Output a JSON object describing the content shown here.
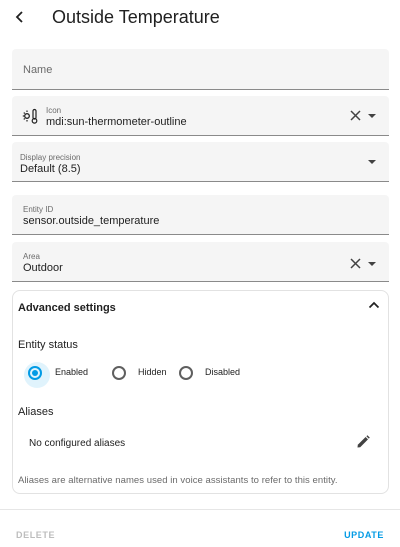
{
  "header": {
    "title": "Outside Temperature"
  },
  "fields": {
    "name": {
      "label": "Name"
    },
    "icon": {
      "label": "Icon",
      "value": "mdi:sun-thermometer-outline"
    },
    "precision": {
      "label": "Display precision",
      "value": "Default (8.5)"
    },
    "entity_id": {
      "label": "Entity ID",
      "value": "sensor.outside_temperature"
    },
    "area": {
      "label": "Area",
      "value": "Outdoor"
    }
  },
  "advanced": {
    "title": "Advanced settings",
    "entity_status": {
      "label": "Entity status",
      "options": [
        "Enabled",
        "Hidden",
        "Disabled"
      ],
      "selected": "Enabled"
    },
    "aliases": {
      "label": "Aliases",
      "empty_text": "No configured aliases",
      "helper": "Aliases are alternative names used in voice assistants to refer to this entity."
    }
  },
  "footer": {
    "delete_label": "DELETE",
    "update_label": "UPDATE"
  },
  "colors": {
    "accent": "#039be5",
    "disabled": "#bdbdbd",
    "field_bg": "#f5f5f5"
  }
}
